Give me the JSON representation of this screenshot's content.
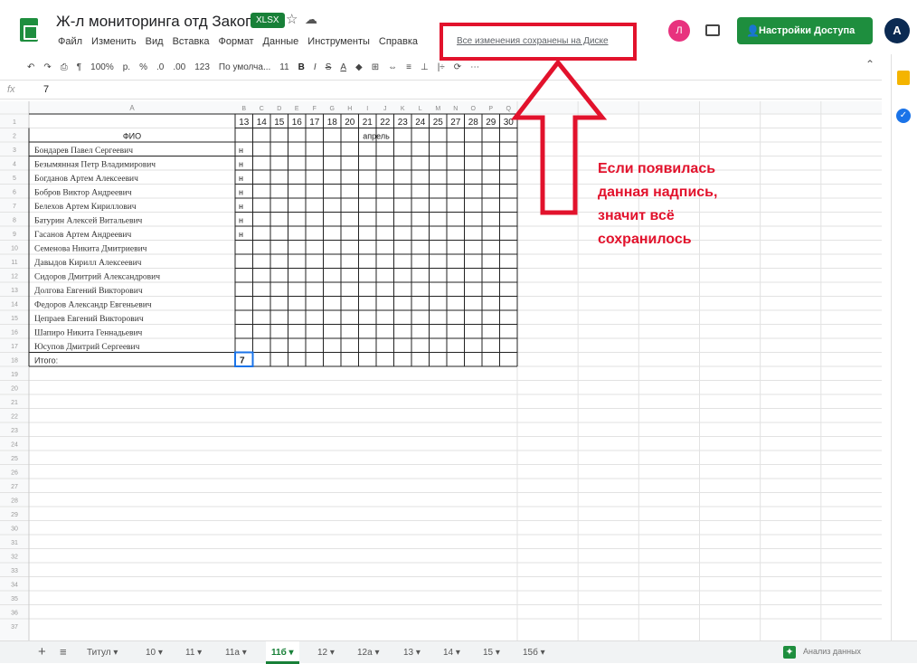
{
  "app": {
    "title": "Ж-л мониторинга отд Закопко",
    "format_badge": "XLSX",
    "save_status": "Все изменения сохранены на Диске",
    "share_label": "Настройки Доступа",
    "user_initial": "A",
    "collab_initial": "Л"
  },
  "menu": [
    "Файл",
    "Изменить",
    "Вид",
    "Вставка",
    "Формат",
    "Данные",
    "Инструменты",
    "Справка"
  ],
  "toolbar": {
    "zoom": "100%",
    "currency": "р.",
    "percent": "%",
    "dec_minus": ".0",
    "dec_plus": ".00",
    "number_format": "123",
    "font": "По умолча...",
    "font_size": "11",
    "bold": "B",
    "italic": "I",
    "strike": "S",
    "text_color": "A"
  },
  "formula_bar": {
    "fx": "fx",
    "value": "7"
  },
  "col_letters": [
    "A",
    "B",
    "C",
    "D",
    "E",
    "F",
    "G",
    "H",
    "I",
    "J",
    "K",
    "L",
    "M",
    "N",
    "O",
    "P",
    "Q",
    "R",
    "S",
    "T",
    "U",
    "V",
    "W",
    "X"
  ],
  "day_numbers": [
    "13",
    "14",
    "15",
    "16",
    "17",
    "18",
    "20",
    "21",
    "22",
    "23",
    "24",
    "25",
    "27",
    "28",
    "29",
    "30"
  ],
  "header": {
    "fio": "ФИО",
    "month": "апрель"
  },
  "students": [
    "Бондарев Павел Сергеевич",
    "Безымянная Петр Владимирович",
    "Богданов Артем Алексеевич",
    "Бобров Виктор Андреевич",
    "Белехов Артем Кириллович",
    "Батурин Алексей Витальевич",
    "Гасанов Артем Андреевич",
    "Семенова Никита Дмитриевич",
    "Давыдов Кирилл Алексеевич",
    "Сидоров Дмитрий Александрович",
    "Долгова Евгений Викторович",
    "Федоров Александр Евгеньевич",
    "Цепраев Евгений Викторович",
    "Шапиро Никита Геннадьевич",
    "Юсупов Дмитрий Сергеевич"
  ],
  "marks": [
    "н",
    "н",
    "н",
    "н",
    "н",
    "н",
    "н"
  ],
  "total_label": "Итого:",
  "total_value": "7",
  "annotation": "Если появилась данная надпись, значит всё сохранилось",
  "sheet_tabs": [
    "Титул",
    "10",
    "11",
    "11а",
    "11б",
    "12",
    "12а",
    "13",
    "14",
    "15",
    "15б"
  ],
  "active_tab": "11б",
  "explore": "Анализ данных"
}
